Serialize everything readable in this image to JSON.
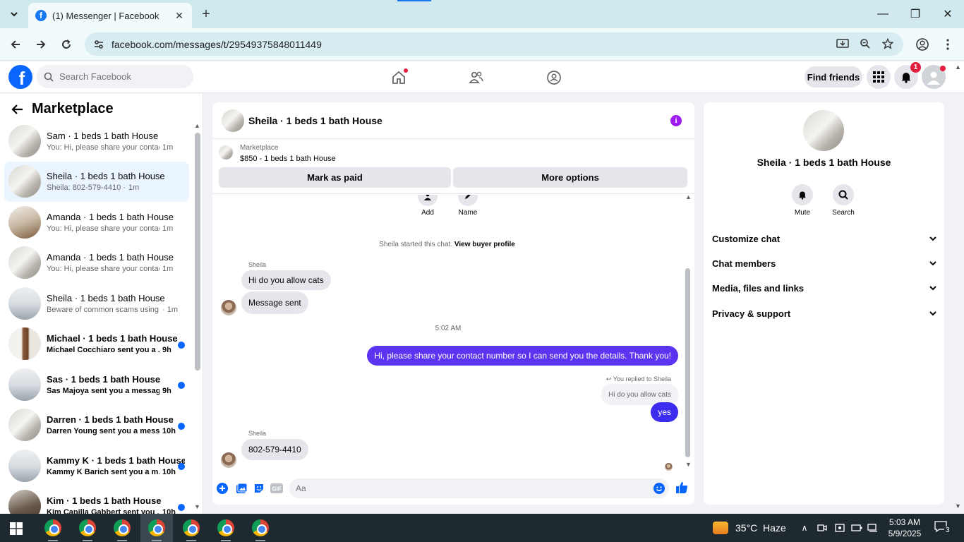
{
  "browser": {
    "tab_title": "(1) Messenger | Facebook",
    "url": "facebook.com/messages/t/29549375848011449"
  },
  "fb_header": {
    "search_placeholder": "Search Facebook",
    "find_friends": "Find friends",
    "notification_count": "1"
  },
  "left_panel": {
    "title": "Marketplace",
    "conversations": [
      {
        "name": "Sam · 1 beds 1 bath House",
        "snippet": "You: Hi, please share your contact ...",
        "time": "1m",
        "unread": false,
        "active": false
      },
      {
        "name": "Sheila · 1 beds 1 bath House",
        "snippet": "Sheila: 802-579-4410 ·",
        "time": "1m",
        "unread": false,
        "active": true
      },
      {
        "name": "Amanda · 1 beds 1 bath House",
        "snippet": "You: Hi, please share your contact ...",
        "time": "1m",
        "unread": false,
        "active": false
      },
      {
        "name": "Amanda · 1 beds 1 bath House",
        "snippet": "You: Hi, please share your contact ...",
        "time": "1m",
        "unread": false,
        "active": false
      },
      {
        "name": "Sheila · 1 beds 1 bath House",
        "snippet": "Beware of common scams using ...",
        "time": "· 1m",
        "unread": false,
        "active": false
      },
      {
        "name": "Michael · 1 beds 1 bath House",
        "snippet": "Michael Cocchiaro sent you a ...",
        "time": "9h",
        "unread": true,
        "active": false
      },
      {
        "name": "Sas · 1 beds 1 bath House",
        "snippet": "Sas Majoya sent you a message...",
        "time": "9h",
        "unread": true,
        "active": false
      },
      {
        "name": "Darren · 1 beds 1 bath House",
        "snippet": "Darren Young sent you a mess...",
        "time": "10h",
        "unread": true,
        "active": false
      },
      {
        "name": "Kammy K · 1 beds 1 bath House",
        "snippet": "Kammy K Barich sent you a m...",
        "time": "10h",
        "unread": true,
        "active": false
      },
      {
        "name": "Kim · 1 beds 1 bath House",
        "snippet": "Kim Capilla Gabbert sent you ...",
        "time": "10h",
        "unread": true,
        "active": false
      }
    ]
  },
  "chat": {
    "title": "Sheila · 1 beds 1 bath House",
    "marketplace_label": "Marketplace",
    "listing": "$850 - 1 beds 1 bath House",
    "mark_as_paid": "Mark as paid",
    "more_options": "More options",
    "action_add": "Add",
    "action_name": "Name",
    "system_text": "Sheila started this chat.",
    "system_link": "View buyer profile",
    "sender1": "Sheila",
    "msg1": "Hi do you allow cats",
    "msg2": "Message sent",
    "timestamp": "5:02 AM",
    "out_msg1": "Hi, please share your contact number so I can send you the details. Thank you!",
    "replied_label": "You replied to Sheila",
    "quoted": "Hi do you allow cats",
    "out_msg2": "yes",
    "sender2": "Sheila",
    "msg3": "802-579-4410",
    "composer_placeholder": "Aa"
  },
  "right_panel": {
    "name": "Sheila · 1 beds 1 bath House",
    "mute": "Mute",
    "search": "Search",
    "sections": [
      "Customize chat",
      "Chat members",
      "Media, files and links",
      "Privacy & support"
    ]
  },
  "taskbar": {
    "weather": "35°C  Haze",
    "time": "5:03 AM",
    "date": "5/9/2025",
    "notifications": "3"
  },
  "colors": {
    "fb_blue": "#0866ff",
    "outgoing_bubble": "#5b34f0",
    "info_purple": "#9b1bf0"
  }
}
